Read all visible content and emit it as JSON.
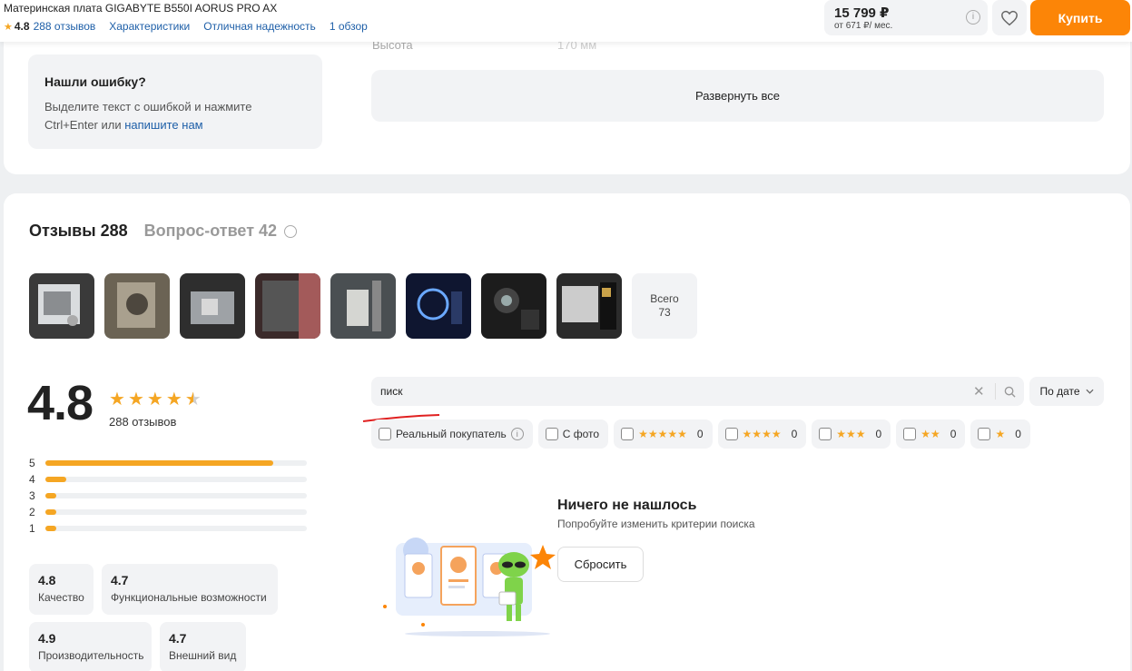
{
  "header": {
    "product_title": "Материнская плата GIGABYTE B550I AORUS PRO AX",
    "rating": "4.8",
    "reviews_link": "288 отзывов",
    "specs_link": "Характеристики",
    "reliability_link": "Отличная надежность",
    "overview_link": "1 обзор",
    "price": "15 799 ₽",
    "installment": "от 671 ₽/ мес.",
    "buy_label": "Купить"
  },
  "specs": {
    "ghost_label": "Высота",
    "ghost_value": "170 мм",
    "expand_label": "Развернуть все"
  },
  "error_box": {
    "title": "Нашли ошибку?",
    "text": "Выделите текст с ошибкой и нажмите Ctrl+Enter или ",
    "link": "напишите нам"
  },
  "reviews": {
    "tab_reviews": "Отзывы 288",
    "tab_qa": "Вопрос-ответ 42",
    "all_label": "Всего",
    "all_count": "73",
    "rating": "4.8",
    "count_label": "288 отзывов",
    "distribution": [
      {
        "star": "5",
        "fraction": 0.87
      },
      {
        "star": "4",
        "fraction": 0.08
      },
      {
        "star": "3",
        "fraction": 0.04
      },
      {
        "star": "2",
        "fraction": 0.04
      },
      {
        "star": "1",
        "fraction": 0.04
      }
    ],
    "criteria": [
      {
        "value": "4.8",
        "name": "Качество"
      },
      {
        "value": "4.7",
        "name": "Функциональные возможности"
      },
      {
        "value": "4.9",
        "name": "Производительность"
      },
      {
        "value": "4.7",
        "name": "Внешний вид"
      }
    ]
  },
  "search": {
    "value": "писк",
    "sort_label": "По дате"
  },
  "filters": {
    "real_buyer": "Реальный покупатель",
    "with_photo": "С фото",
    "star_filters": [
      {
        "stars": 5,
        "count": "0"
      },
      {
        "stars": 4,
        "count": "0"
      },
      {
        "stars": 3,
        "count": "0"
      },
      {
        "stars": 2,
        "count": "0"
      },
      {
        "stars": 1,
        "count": "0"
      }
    ]
  },
  "empty_state": {
    "title": "Ничего не нашлось",
    "subtitle": "Попробуйте изменить критерии поиска",
    "reset_label": "Сбросить"
  },
  "colors": {
    "accent_orange": "#fc8507",
    "star": "#f5a623",
    "link": "#1e5fa8"
  }
}
